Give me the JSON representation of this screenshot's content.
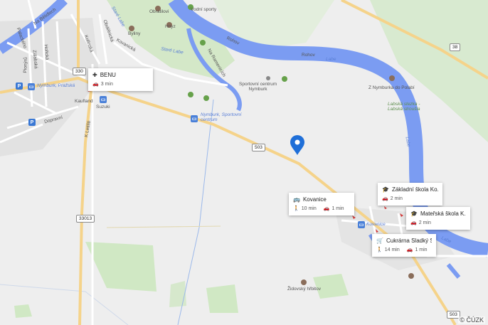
{
  "map": {
    "copyright": "© ČÚZK",
    "colors": {
      "water": "#7b9cf2",
      "road_primary": "#f5d38a",
      "land": "#eeeeee",
      "green": "#cfe6c2",
      "marker": "#1f6fd8"
    }
  },
  "place_labels": {
    "obratilovi": "Obratilovi",
    "vodni_sporty": "Vodní sporty",
    "hrivy": "Hnyz",
    "byliny": "Byliny",
    "na_belidlech": "Na Bělidlech",
    "kolinska": "Kolínská",
    "obdelnicka": "Obdélnická",
    "kovanicka": "Kovanická",
    "stare_labe_1": "Staré Labe",
    "stare_labe_2": "Staré Labe",
    "na_ramenicich": "Na Ramenicích",
    "rohov_1": "Rohov",
    "rohov_2": "Rohov",
    "labe_top": "Labe",
    "palackeho": "Palackého",
    "horiciska": "Hořická",
    "zalabska": "Zálabská",
    "pionyru": "Pionýrů",
    "nymburk_prazska": "Nymburk, Pražská",
    "kaufland": "Kaufland",
    "suzuki": "Suzuki",
    "dopravni": "Dopravní",
    "k_letisti": "K Letišti",
    "sportovni_centrum": "Sportovní centrum\nNymburk",
    "nymburk_sportovni": "Nymburk, Sportovní\ncentrum",
    "z_nymburka": "Z Nymburka do Polabí",
    "labska_stezka": "Labská stezka -\nLabská stroušla",
    "labe_side": "Labe",
    "labe_bottom": "Labe",
    "kovanice": "Kovanice",
    "zidovsky_hrbitov": "Židovský hřbitov"
  },
  "road_shields": [
    "330",
    "503",
    "33013",
    "503",
    "38"
  ],
  "popups": [
    {
      "title": "BENU",
      "icon": "pharmacy-icon",
      "time_car": "3 min"
    },
    {
      "title": "Kovanice",
      "icon": "bus-icon",
      "time_walk": "10 min",
      "time_car": "1 min"
    },
    {
      "title": "Základní škola Ko...",
      "icon": "school-icon",
      "time_car": "2 min"
    },
    {
      "title": "Mateřská škola K...",
      "icon": "school-icon",
      "time_car": "2 min"
    },
    {
      "title": "Cukrárna Sladký S...",
      "icon": "shop-icon",
      "time_walk": "14 min",
      "time_car": "1 min"
    }
  ]
}
